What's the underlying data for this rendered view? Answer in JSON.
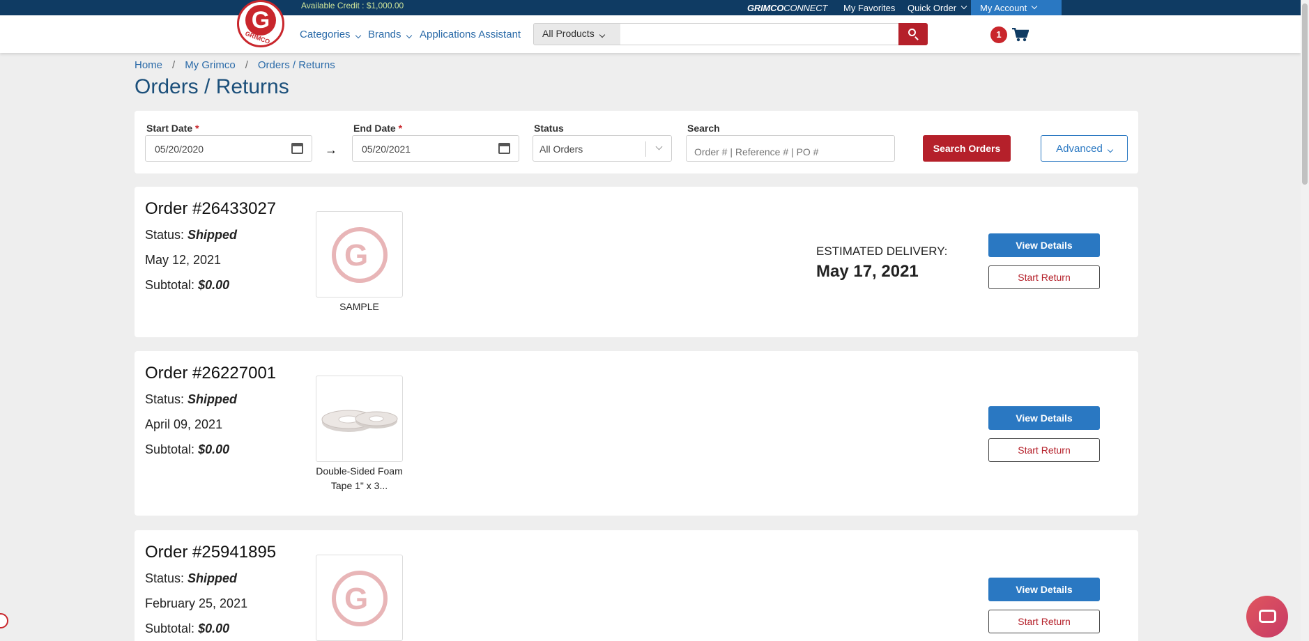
{
  "topbar": {
    "credit": "Available Credit : $1,000.00",
    "brand_bold": "GRIMCO",
    "brand_light": "CONNECT",
    "favorites": "My Favorites",
    "quick_order": "Quick Order",
    "my_account": "My Account"
  },
  "header": {
    "logo_text": "GRIMCO",
    "logo_letter": "G",
    "categories": "Categories",
    "brands": "Brands",
    "apps": "Applications Assistant",
    "product_select": "All Products",
    "cart_count": "1"
  },
  "breadcrumb": [
    "Home",
    "My Grimco",
    "Orders / Returns"
  ],
  "page_title": "Orders / Returns",
  "filter": {
    "start_label": "Start Date",
    "end_label": "End Date",
    "required_mark": "*",
    "arrow": "→",
    "start_value": "05/20/2020",
    "end_value": "05/20/2021",
    "status_label": "Status",
    "status_value": "All Orders",
    "search_label": "Search",
    "search_placeholder": "Order # | Reference # | PO #",
    "search_btn": "Search Orders",
    "advanced_btn": "Advanced"
  },
  "orders": [
    {
      "number": "Order #26433027",
      "status_prefix": "Status: ",
      "status": "Shipped",
      "date": "May 12, 2021",
      "subtotal_prefix": "Subtotal: ",
      "subtotal": "$0.00",
      "caption": "SAMPLE",
      "eta_label": "ESTIMATED DELIVERY:",
      "eta_date": "May 17, 2021",
      "view": "View Details",
      "return": "Start Return"
    },
    {
      "number": "Order #26227001",
      "status_prefix": "Status: ",
      "status": "Shipped",
      "date": "April 09, 2021",
      "subtotal_prefix": "Subtotal: ",
      "subtotal": "$0.00",
      "caption": "Double-Sided Foam Tape 1\" x 3...",
      "view": "View Details",
      "return": "Start Return"
    },
    {
      "number": "Order #25941895",
      "status_prefix": "Status: ",
      "status": "Shipped",
      "date": "February 25, 2021",
      "subtotal_prefix": "Subtotal: ",
      "subtotal": "$0.00",
      "view": "View Details",
      "return": "Start Return"
    }
  ],
  "colors": {
    "navy": "#0f3b63",
    "brand_red": "#b5202a",
    "accent_blue": "#2a78c2"
  }
}
